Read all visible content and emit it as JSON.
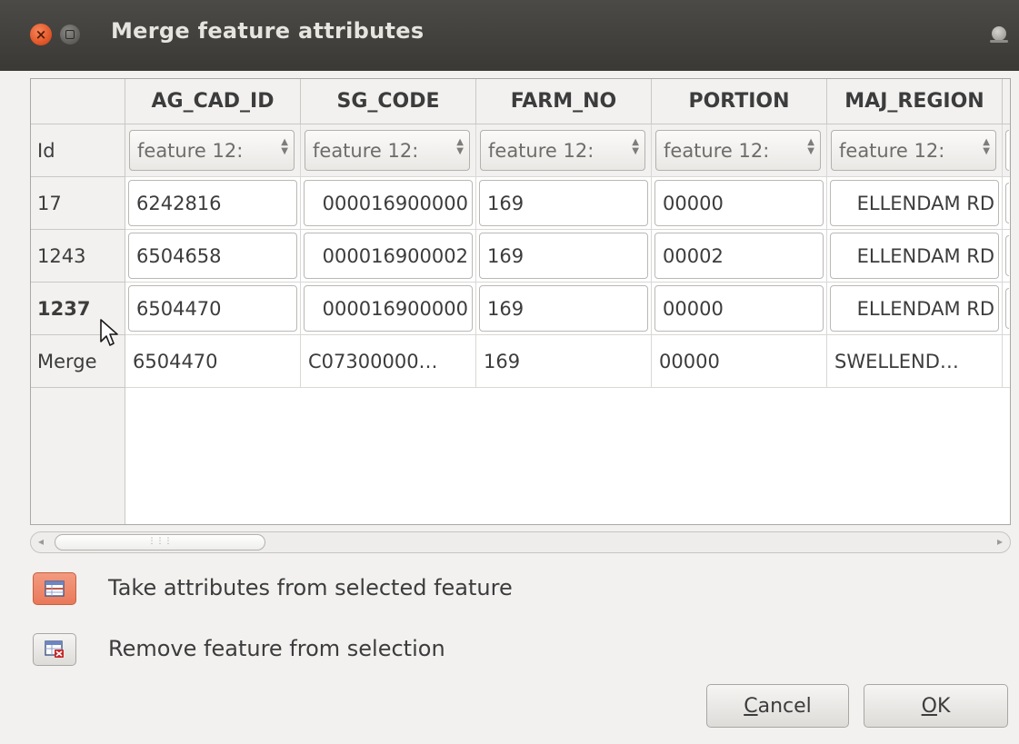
{
  "window": {
    "title": "Merge feature attributes"
  },
  "table": {
    "corner": "",
    "columns": [
      "AG_CAD_ID",
      "SG_CODE",
      "FARM_NO",
      "PORTION",
      "MAJ_REGION"
    ],
    "id_row": {
      "label": "Id",
      "combos": [
        "feature 12:",
        "feature 12:",
        "feature 12:",
        "feature 12:",
        "feature 12:"
      ]
    },
    "rows": [
      {
        "label": "17",
        "values": [
          "6242816",
          "000016900000",
          "169",
          "00000",
          "ELLENDAM RD"
        ]
      },
      {
        "label": "1243",
        "values": [
          "6504658",
          "000016900002",
          "169",
          "00002",
          "ELLENDAM RD"
        ]
      },
      {
        "label": "1237",
        "values": [
          "6504470",
          "000016900000",
          "169",
          "00000",
          "ELLENDAM RD"
        ]
      }
    ],
    "merge_row": {
      "label": "Merge",
      "values": [
        "6504470",
        "C07300000…",
        "169",
        "00000",
        "SWELLEND…"
      ]
    }
  },
  "actions": {
    "take_label": "Take attributes from selected feature",
    "remove_label": "Remove feature from selection"
  },
  "buttons": {
    "cancel_first": "C",
    "cancel_rest": "ancel",
    "ok_first": "O",
    "ok_rest": "K"
  },
  "colors": {
    "titlebar": "#3c3b37",
    "close_button": "#e2582a",
    "take_button": "#ee8565"
  },
  "icons": [
    "close-icon",
    "maximize-icon",
    "table-select-icon",
    "table-remove-icon",
    "mouse-pointer-icon"
  ]
}
